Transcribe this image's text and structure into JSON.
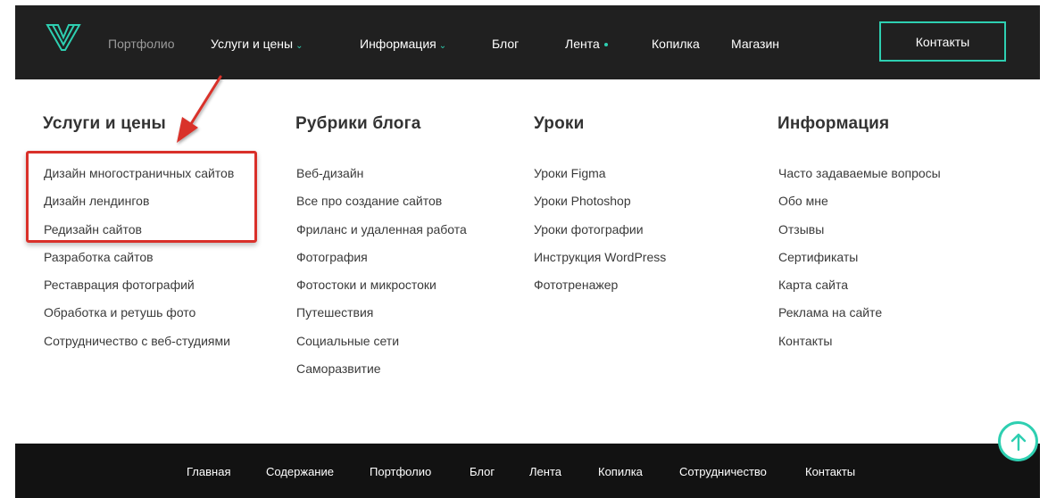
{
  "header": {
    "nav": [
      {
        "label": "Портфолио"
      },
      {
        "label": "Услуги и цены"
      },
      {
        "label": "Информация"
      },
      {
        "label": "Блог"
      },
      {
        "label": "Лента"
      },
      {
        "label": "Копилка"
      },
      {
        "label": "Магазин"
      }
    ],
    "contacts_button": "Контакты"
  },
  "menu": {
    "columns": [
      {
        "title": "Услуги и цены",
        "items": [
          "Дизайн многостраничных сайтов",
          "Дизайн лендингов",
          "Редизайн сайтов",
          "Разработка сайтов",
          "Реставрация фотографий",
          "Обработка и ретушь фото",
          "Сотрудничество с веб-студиями"
        ]
      },
      {
        "title": "Рубрики блога",
        "items": [
          "Веб-дизайн",
          "Все про создание сайтов",
          "Фриланс и удаленная работа",
          "Фотография",
          "Фотостоки и микростоки",
          "Путешествия",
          "Социальные сети",
          "Саморазвитие"
        ]
      },
      {
        "title": "Уроки",
        "items": [
          "Уроки Figma",
          "Уроки Photoshop",
          "Уроки фотографии",
          "Инструкция WordPress",
          "Фототренажер"
        ]
      },
      {
        "title": "Информация",
        "items": [
          "Часто задаваемые вопросы",
          "Обо мне",
          "Отзывы",
          "Сертификаты",
          "Карта сайта",
          "Реклама на сайте",
          "Контакты"
        ]
      }
    ]
  },
  "footer": {
    "links": [
      "Главная",
      "Содержание",
      "Портфолио",
      "Блог",
      "Лента",
      "Копилка",
      "Сотрудничество",
      "Контакты"
    ]
  },
  "colors": {
    "accent": "#2ecfb1",
    "header_bg": "#202020",
    "footer_bg": "#121212",
    "highlight": "#d9302a"
  },
  "icons": {
    "logo": "logo-icon",
    "scroll_top": "arrow-up-icon"
  }
}
